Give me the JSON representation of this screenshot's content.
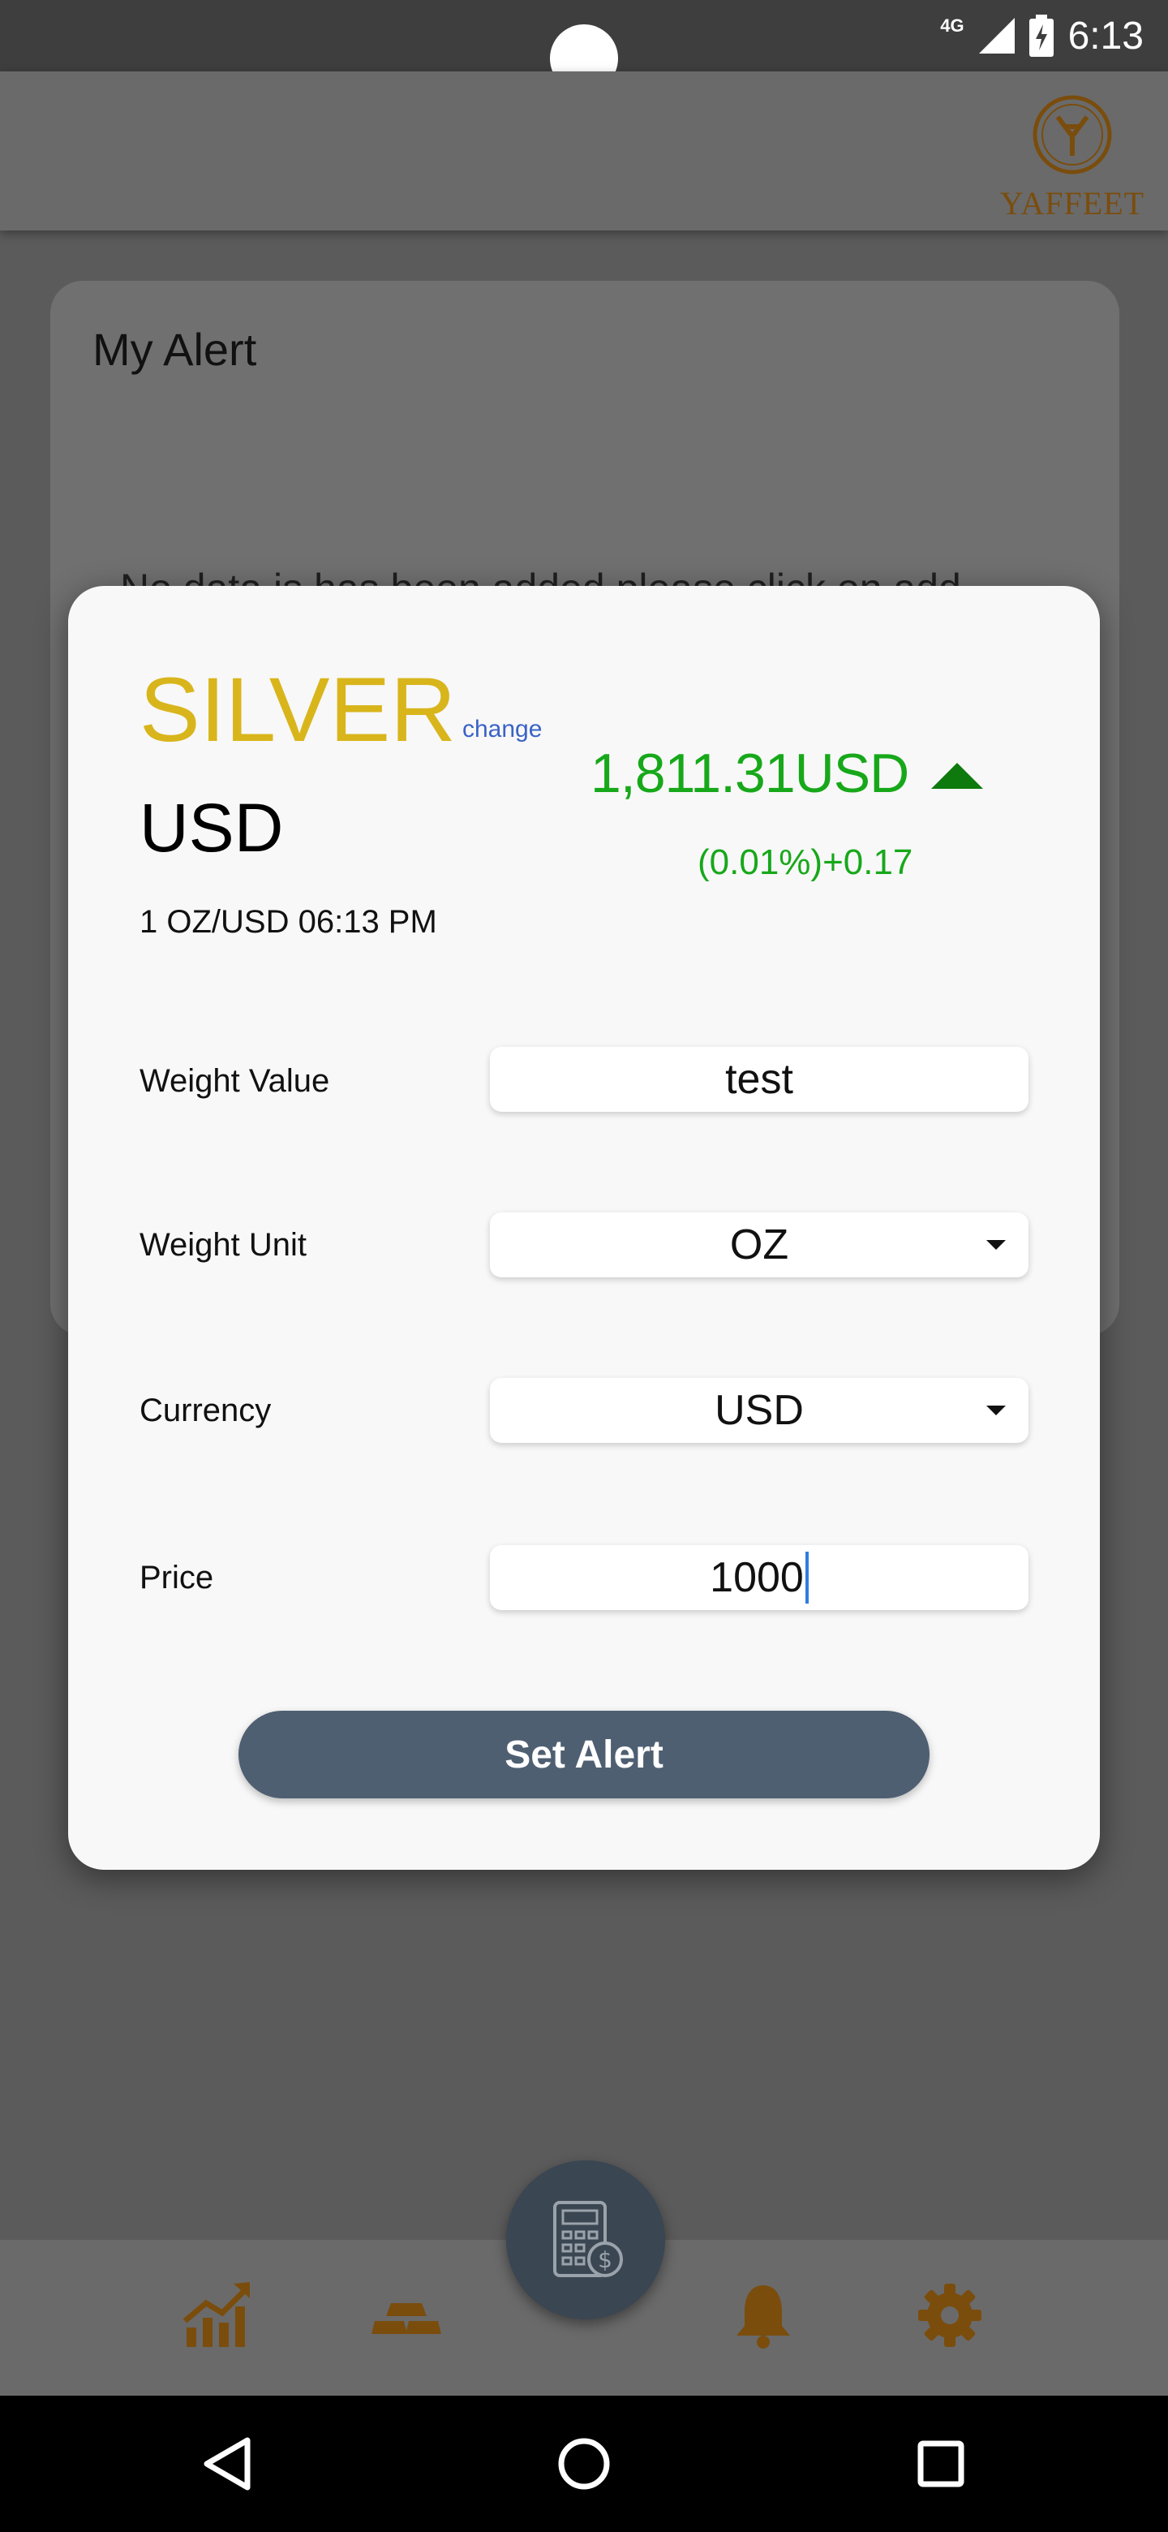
{
  "status_bar": {
    "network": "4G",
    "time": "6:13"
  },
  "header": {
    "brand": "YAFFEET"
  },
  "background_card": {
    "title": "My Alert",
    "empty_message": "No data is has been added please click on add"
  },
  "modal": {
    "metal": "SILVER",
    "change_link": "change",
    "currency": "USD",
    "quote_time": "1 OZ/USD 06:13 PM",
    "price": "1,811.31USD",
    "price_change": "(0.01%)+0.17",
    "fields": {
      "weight_value": {
        "label": "Weight Value",
        "value": "test"
      },
      "weight_unit": {
        "label": "Weight Unit",
        "value": "OZ"
      },
      "currency": {
        "label": "Currency",
        "value": "USD"
      },
      "price": {
        "label": "Price",
        "value": "1000"
      }
    },
    "submit_label": "Set Alert"
  },
  "bottom_nav": {
    "items": [
      "chart-icon",
      "gold-bars-icon",
      "calculator-icon",
      "bell-icon",
      "gear-icon"
    ]
  },
  "colors": {
    "metal": "#d9b51c",
    "positive": "#17a81a",
    "button": "#4f5f72",
    "nav_icon": "#7a4d0d"
  }
}
